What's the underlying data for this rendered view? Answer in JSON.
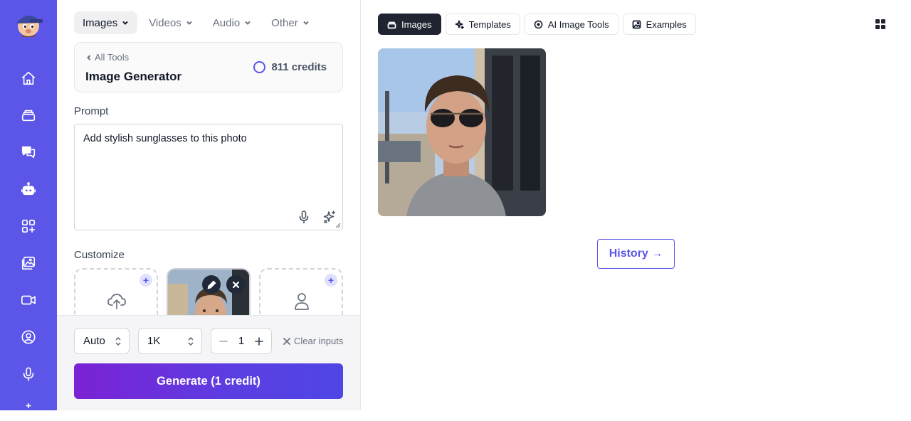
{
  "rail": {
    "items": [
      {
        "icon": "home-icon"
      },
      {
        "icon": "layers-icon"
      },
      {
        "icon": "chat-icon"
      },
      {
        "icon": "robot-icon"
      },
      {
        "icon": "apps-icon"
      },
      {
        "icon": "gallery-icon"
      },
      {
        "icon": "video-icon"
      },
      {
        "icon": "user-circle-icon"
      },
      {
        "icon": "mic-icon"
      }
    ]
  },
  "category_tabs": [
    {
      "label": "Images",
      "active": true
    },
    {
      "label": "Videos",
      "active": false
    },
    {
      "label": "Audio",
      "active": false
    },
    {
      "label": "Other",
      "active": false
    }
  ],
  "tool": {
    "back_label": "All Tools",
    "title": "Image Generator",
    "credits": "811 credits"
  },
  "prompt": {
    "label": "Prompt",
    "value": "Add stylish sunglasses to this photo"
  },
  "customize": {
    "label": "Customize"
  },
  "controls": {
    "aspect": "Auto",
    "resolution": "1K",
    "count": "1",
    "clear_label": "Clear inputs",
    "generate_label": "Generate (1 credit)"
  },
  "main_tabs": [
    {
      "label": "Images",
      "icon": "stack-icon",
      "active": true
    },
    {
      "label": "Templates",
      "icon": "sparkle-icon",
      "active": false
    },
    {
      "label": "AI Image Tools",
      "icon": "dashed-circle-icon",
      "active": false
    },
    {
      "label": "Examples",
      "icon": "image-icon",
      "active": false
    }
  ],
  "history_label": "History →",
  "colors": {
    "accent": "#5b56e8",
    "generate_start": "#7b22d4",
    "generate_end": "#4f46e5",
    "active_tab": "#1f2430"
  }
}
